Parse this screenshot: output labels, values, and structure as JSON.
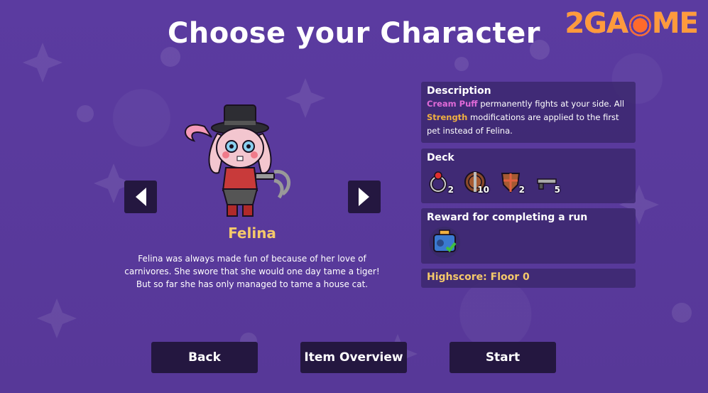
{
  "title": "Choose your Character",
  "logo": {
    "text_a": "2GA",
    "text_b": "ME"
  },
  "character": {
    "name": "Felina",
    "description": "Felina was always made fun of because of her love of carnivores. She swore that she would one day tame a tiger! But so far she has only managed to tame a house cat."
  },
  "panels": {
    "description": {
      "title": "Description",
      "pet": "Cream Puff",
      "text1": " permanently fights at your side. All ",
      "stat": "Strength",
      "text2": " modifications are applied to the first pet instead of Felina."
    },
    "deck": {
      "title": "Deck",
      "items": [
        {
          "icon": "ring-icon",
          "count": "2"
        },
        {
          "icon": "round-shield-icon",
          "count": "10"
        },
        {
          "icon": "kite-shield-icon",
          "count": "2"
        },
        {
          "icon": "gun-icon",
          "count": "5"
        }
      ]
    },
    "reward": {
      "title": "Reward for completing a run",
      "item": "pet-carrier-icon"
    },
    "highscore": {
      "text": "Highscore: Floor 0"
    }
  },
  "buttons": {
    "back": "Back",
    "items": "Item Overview",
    "start": "Start"
  },
  "colors": {
    "background": "#5a3a9c",
    "button": "#241740",
    "accent_gold": "#f5c96a",
    "pink": "#e06ad8",
    "orange": "#f0b040"
  }
}
